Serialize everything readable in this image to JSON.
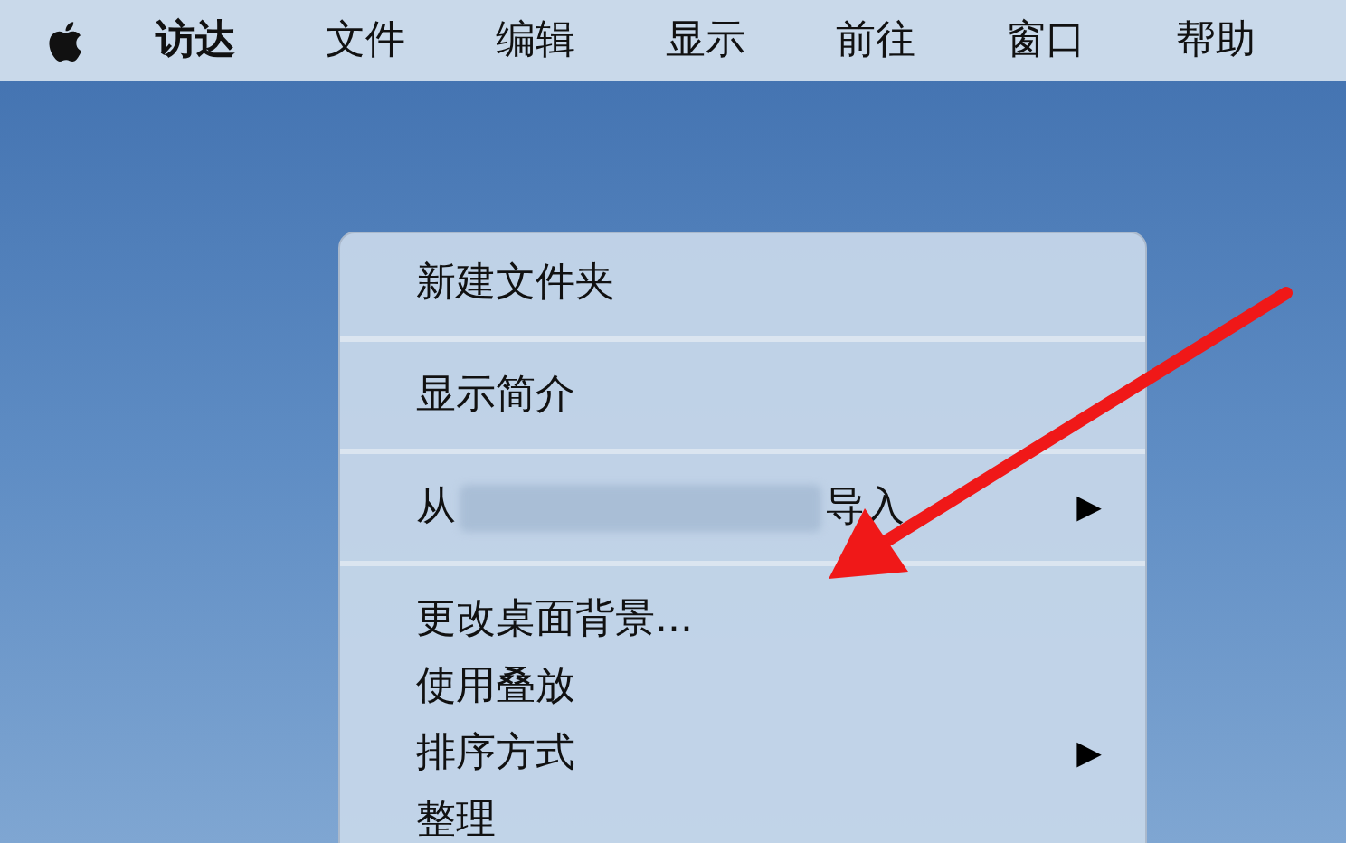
{
  "menu_bar": {
    "items": [
      {
        "label": "访达",
        "kind": "app"
      },
      {
        "label": "文件",
        "kind": "menu"
      },
      {
        "label": "编辑",
        "kind": "menu"
      },
      {
        "label": "显示",
        "kind": "menu"
      },
      {
        "label": "前往",
        "kind": "menu"
      },
      {
        "label": "窗口",
        "kind": "menu"
      },
      {
        "label": "帮助",
        "kind": "menu"
      }
    ]
  },
  "context_menu": {
    "items": [
      {
        "kind": "item",
        "label": "新建文件夹"
      },
      {
        "kind": "separator"
      },
      {
        "kind": "item",
        "label": "显示简介"
      },
      {
        "kind": "separator"
      },
      {
        "kind": "blurred",
        "label_before": "从",
        "label_after": "导入",
        "submenu_arrow": "▶"
      },
      {
        "kind": "separator"
      },
      {
        "kind": "item",
        "label": "更改桌面背景..."
      },
      {
        "kind": "item",
        "label": "使用叠放"
      },
      {
        "kind": "item",
        "label": "排序方式",
        "submenu_arrow": "▶"
      },
      {
        "kind": "item",
        "label": "整理"
      }
    ]
  }
}
